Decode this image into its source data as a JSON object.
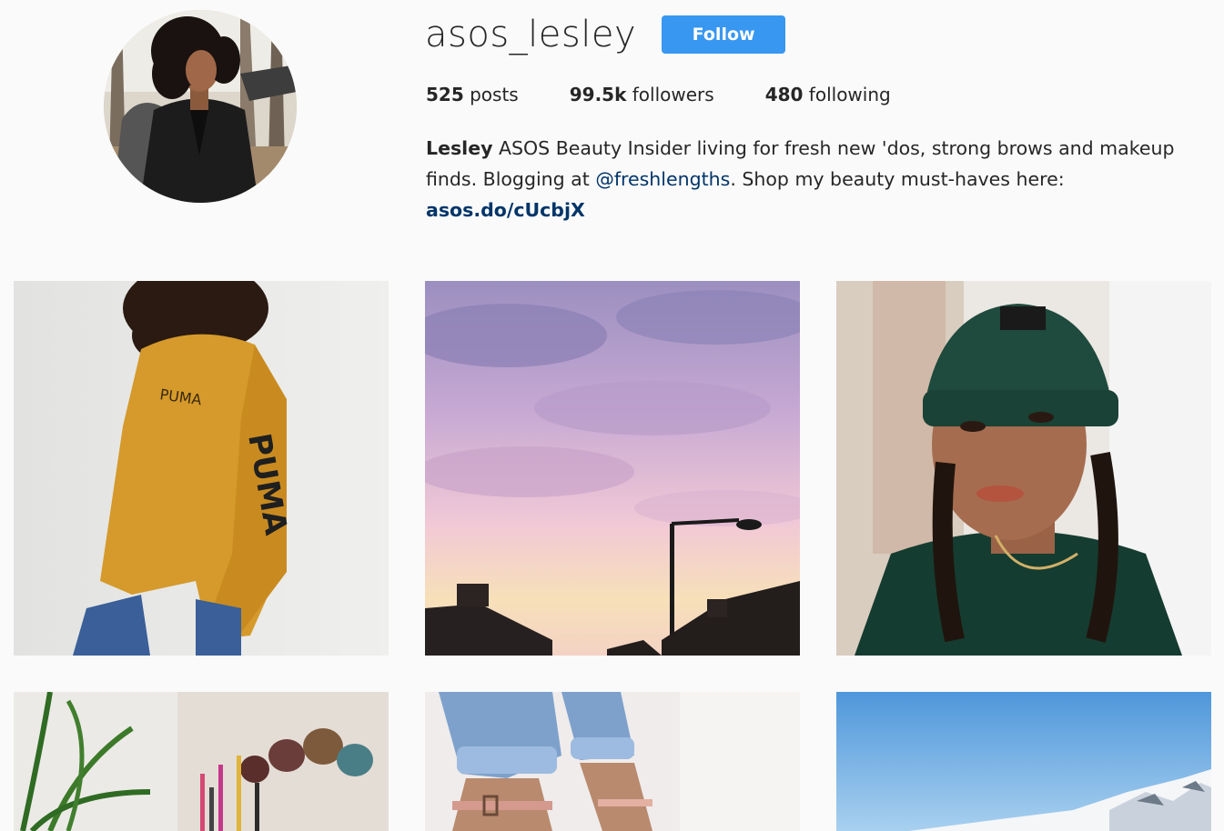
{
  "profile": {
    "username": "asos_lesley",
    "follow_label": "Follow",
    "avatar_icon": "profile-photo"
  },
  "stats": {
    "posts_count": "525",
    "posts_label": "posts",
    "followers_count": "99.5k",
    "followers_label": "followers",
    "following_count": "480",
    "following_label": "following"
  },
  "bio": {
    "name": "Lesley",
    "text_1": "ASOS Beauty Insider living for fresh new 'dos, strong brows and makeup finds. Blogging at",
    "mention": "@freshlengths",
    "text_2": ". Shop my beauty must-haves here:",
    "link": "asos.do/cUcbjX"
  },
  "colors": {
    "follow_button": "#3897f0",
    "link": "#003569",
    "background": "#fafafa"
  },
  "posts": [
    {
      "subject": "woman-in-mustard-puma-sweatshirt",
      "sleeve_text": "PUMA"
    },
    {
      "subject": "pastel-sunset-sky-streetlamp"
    },
    {
      "subject": "woman-in-green-beanie-portrait"
    },
    {
      "subject": "makeup-brushes-and-plant"
    },
    {
      "subject": "rolled-jeans-pink-ankle-strap-shoes"
    },
    {
      "subject": "snowy-mountain-blue-sky"
    }
  ]
}
